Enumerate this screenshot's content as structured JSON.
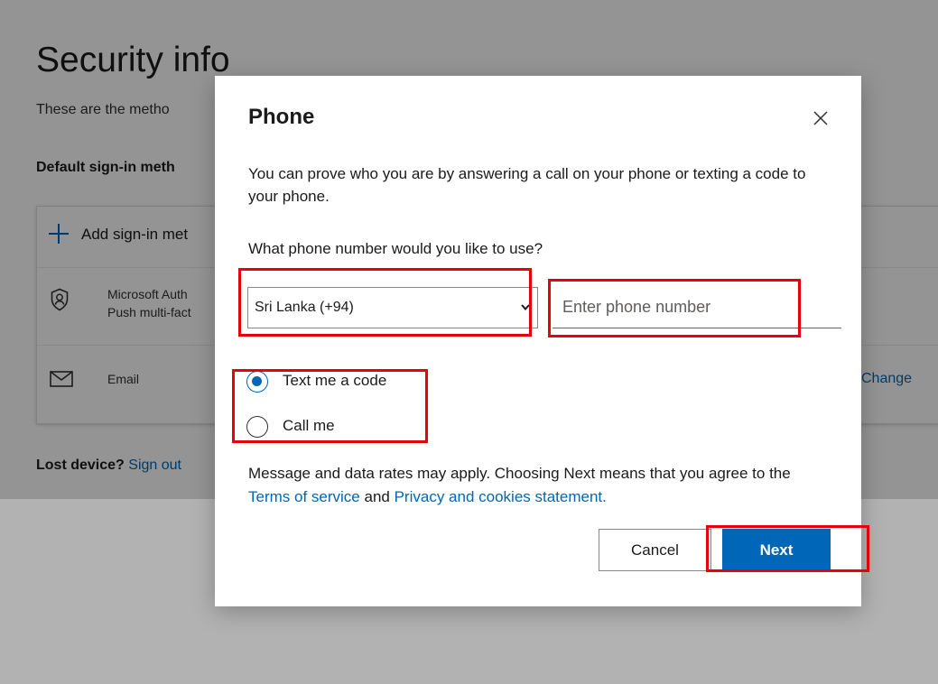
{
  "background_page": {
    "title": "Security info",
    "subtitle": "These are the metho",
    "default_signin_label": "Default sign-in meth",
    "methods": {
      "add_label": "Add sign-in met",
      "authenticator_name": "Microsoft Auth",
      "authenticator_detail": "Push multi-fact",
      "email_label": "Email",
      "change_link": "Change"
    },
    "lost_device": {
      "label": "Lost device?",
      "link": "Sign out"
    }
  },
  "dialog": {
    "title": "Phone",
    "description": "You can prove who you are by answering a call on your phone or texting a code to your phone.",
    "phone_question": "What phone number would you like to use?",
    "country_select": {
      "selected": "Sri Lanka (+94)"
    },
    "phone_input": {
      "placeholder": "Enter phone number",
      "value": ""
    },
    "options": [
      {
        "label": "Text me a code",
        "checked": true
      },
      {
        "label": "Call me",
        "checked": false
      }
    ],
    "disclaimer": {
      "prefix": "Message and data rates may apply. Choosing Next means that you agree to the",
      "terms_link": "Terms of service",
      "conjunction": "and",
      "privacy_link": "Privacy and cookies statement."
    },
    "buttons": {
      "cancel": "Cancel",
      "next": "Next"
    }
  },
  "icons": {
    "close": "close-icon",
    "add": "plus-icon",
    "authenticator": "authenticator-icon",
    "email": "envelope-icon",
    "select_chevron": "chevron-down-icon"
  },
  "colors": {
    "accent": "#0067b8",
    "highlight": "#e8000b",
    "overlay": "rgba(0,0,0,0.42)"
  }
}
